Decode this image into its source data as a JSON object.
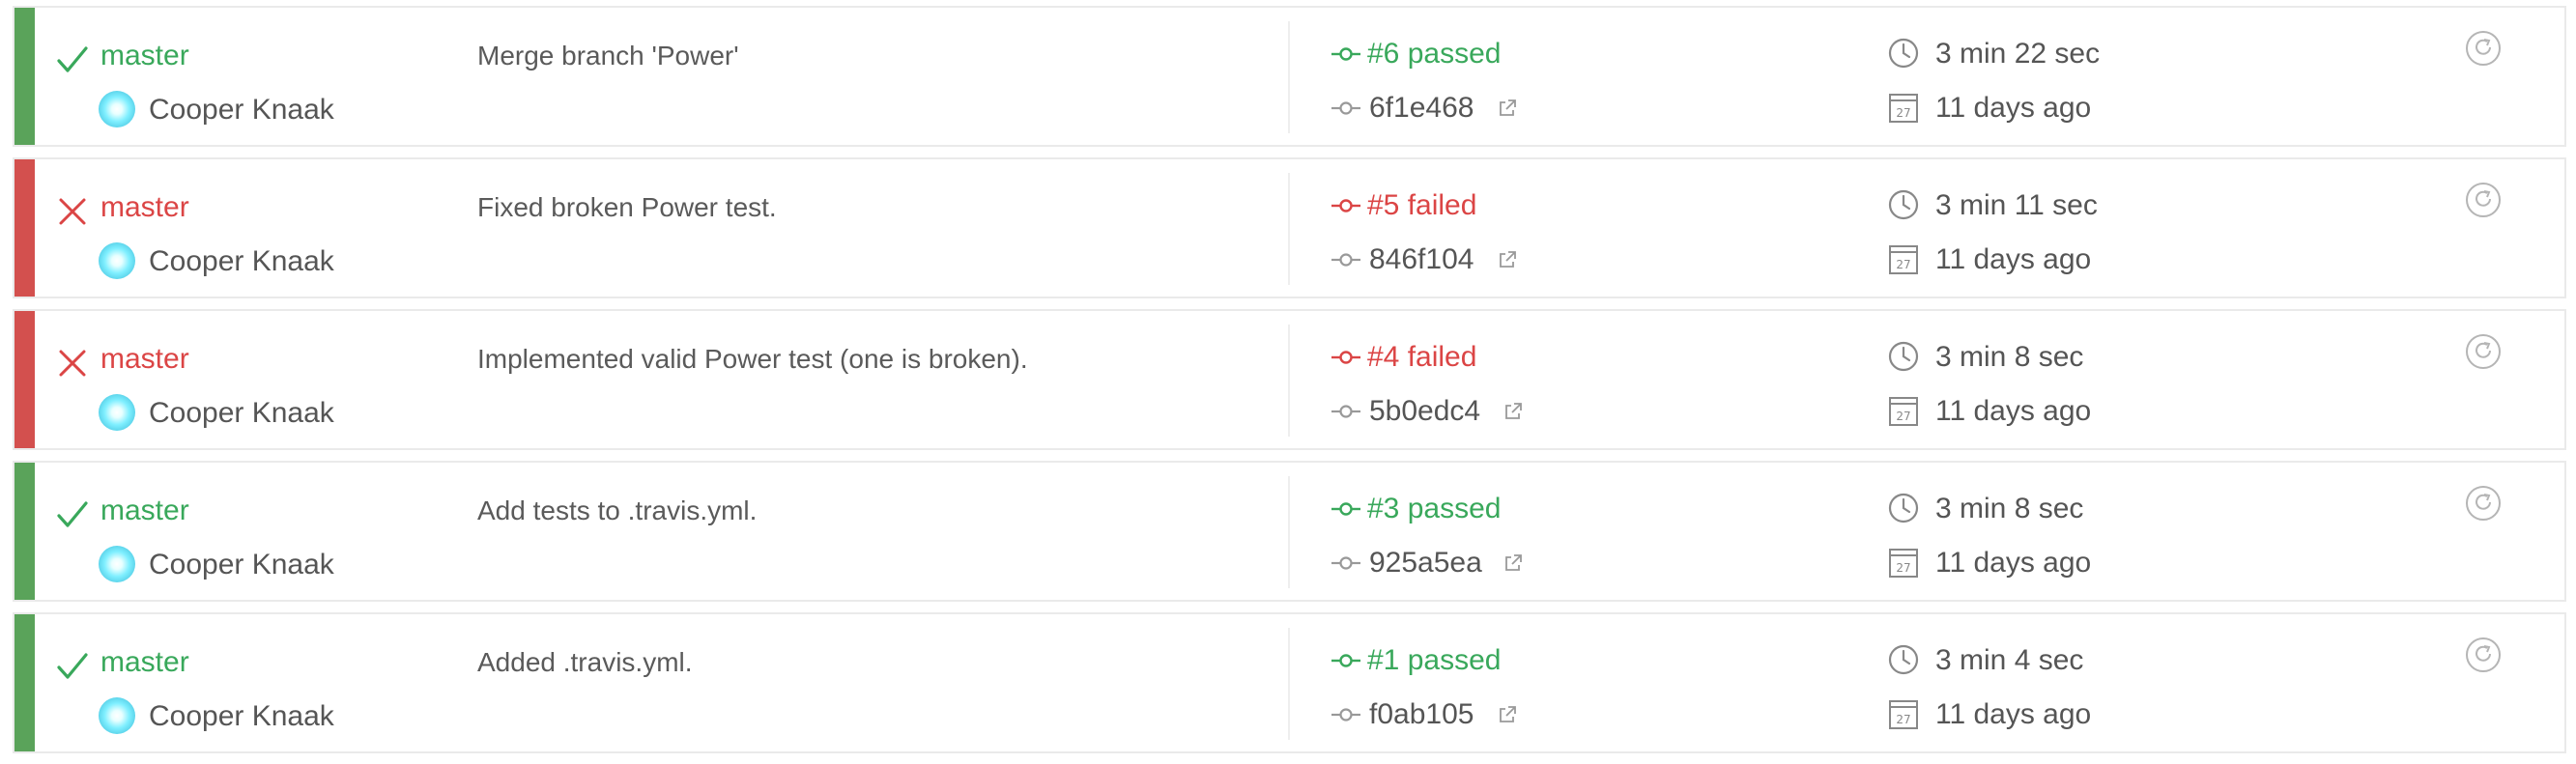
{
  "colors": {
    "passed": "#39a85b",
    "failed": "#db4545",
    "passed_bar": "#5aa35a",
    "failed_bar": "#d3504e"
  },
  "builds": [
    {
      "status": "passed",
      "status_icon": "check-icon",
      "branch": "master",
      "author": "Cooper Knaak",
      "message": "Merge branch 'Power'",
      "build_label": "#6 passed",
      "commit": "6f1e468",
      "duration": "3 min 22 sec",
      "finished": "11 days ago"
    },
    {
      "status": "failed",
      "status_icon": "cross-icon",
      "branch": "master",
      "author": "Cooper Knaak",
      "message": "Fixed broken Power test.",
      "build_label": "#5 failed",
      "commit": "846f104",
      "duration": "3 min 11 sec",
      "finished": "11 days ago"
    },
    {
      "status": "failed",
      "status_icon": "cross-icon",
      "branch": "master",
      "author": "Cooper Knaak",
      "message": "Implemented valid Power test (one is broken).",
      "build_label": "#4 failed",
      "commit": "5b0edc4",
      "duration": "3 min 8 sec",
      "finished": "11 days ago"
    },
    {
      "status": "passed",
      "status_icon": "check-icon",
      "branch": "master",
      "author": "Cooper Knaak",
      "message": "Add tests to .travis.yml.",
      "build_label": "#3 passed",
      "commit": "925a5ea",
      "duration": "3 min 8 sec",
      "finished": "11 days ago"
    },
    {
      "status": "passed",
      "status_icon": "check-icon",
      "branch": "master",
      "author": "Cooper Knaak",
      "message": "Added .travis.yml.",
      "build_label": "#1 passed",
      "commit": "f0ab105",
      "duration": "3 min 4 sec",
      "finished": "11 days ago"
    }
  ],
  "icons": {
    "calendar_day": "27"
  }
}
